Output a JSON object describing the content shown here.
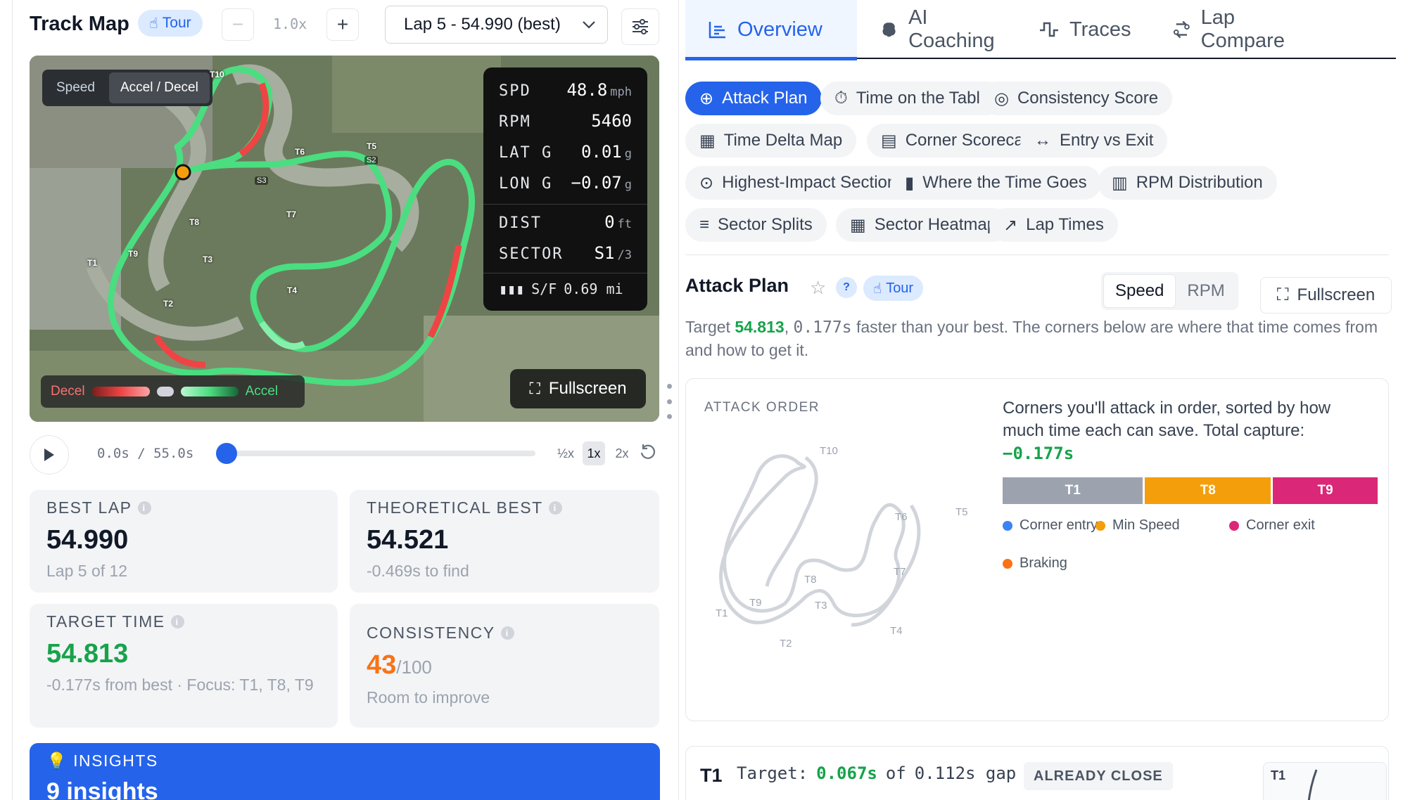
{
  "left": {
    "title": "Track Map",
    "tour_label": "Tour",
    "zoom_minus": "−",
    "zoom_level": "1.0x",
    "zoom_plus": "+",
    "lap_select": "Lap 5 - 54.990 (best)",
    "map": {
      "mode_speed": "Speed",
      "mode_accel": "Accel / Decel",
      "corners": [
        "T1",
        "T2",
        "T3",
        "T4",
        "T5",
        "T6",
        "T7",
        "T8",
        "T9",
        "T10"
      ],
      "sectors": [
        "S2",
        "S3"
      ],
      "telemetry": {
        "spd_label": "SPD",
        "spd_value": "48.8",
        "spd_unit": "mph",
        "rpm_label": "RPM",
        "rpm_value": "5460",
        "latg_label": "LAT G",
        "latg_value": "0.01",
        "latg_unit": "g",
        "long_label": "LON G",
        "long_value": "−0.07",
        "long_unit": "g",
        "dist_label": "DIST",
        "dist_value": "0",
        "dist_unit": "ft",
        "sector_label": "SECTOR",
        "sector_value": "S1",
        "sector_total": "/3",
        "sf_label": "S/F",
        "sf_value": "0.69 mi"
      },
      "legend_decel": "Decel",
      "legend_accel": "Accel",
      "fullscreen": "Fullscreen"
    },
    "playback": {
      "time": "0.0s / 55.0s",
      "progress": 0,
      "speeds": [
        "½x",
        "1x",
        "2x"
      ],
      "active_speed": "1x"
    },
    "cards": {
      "best_lap_label": "BEST LAP",
      "best_lap_value": "54.990",
      "best_lap_sub": "Lap 5 of 12",
      "theo_label": "THEORETICAL BEST",
      "theo_value": "54.521",
      "theo_sub": "-0.469s to find",
      "target_label": "TARGET TIME",
      "target_value": "54.813",
      "target_sub": "-0.177s from best · Focus: T1, T8, T9",
      "consistency_label": "CONSISTENCY",
      "consistency_value": "43",
      "consistency_max": "/100",
      "consistency_sub": "Room to improve"
    },
    "insights": {
      "label": "INSIGHTS",
      "count": "9 insights"
    }
  },
  "right": {
    "tabs": [
      {
        "label": "Overview",
        "icon": "bar-chart-icon"
      },
      {
        "label": "AI Coaching",
        "icon": "brain-icon"
      },
      {
        "label": "Traces",
        "icon": "trace-icon"
      },
      {
        "label": "Lap Compare",
        "icon": "compare-icon"
      }
    ],
    "chips": [
      "Attack Plan",
      "Time on the Table",
      "Consistency Score",
      "Time Delta Map",
      "Corner Scorecard",
      "Entry vs Exit",
      "Highest-Impact Sections",
      "Where the Time Goes",
      "RPM Distribution",
      "Sector Splits",
      "Sector Heatmap",
      "Lap Times"
    ],
    "attack": {
      "title": "Attack Plan",
      "help": "?",
      "tour": "Tour",
      "seg_speed": "Speed",
      "seg_rpm": "RPM",
      "fullscreen": "Fullscreen",
      "desc_pre": "Target ",
      "desc_target": "54.813",
      "desc_delta": "0.177s",
      "desc_post": " faster than your best. The corners below are where that time comes from and how to get it.",
      "order_label": "ATTACK ORDER",
      "order_desc": "Corners you'll attack in order, sorted by how much time each can save. Total capture:",
      "order_total": "−0.177s",
      "stack": [
        {
          "label": "T1",
          "share": 0.067,
          "color": "#9ca3af"
        },
        {
          "label": "T8",
          "share": 0.06,
          "color": "#f59e0b"
        },
        {
          "label": "T9",
          "share": 0.05,
          "color": "#db2777"
        }
      ],
      "legend": [
        {
          "label": "Corner entry",
          "color": "#3b82f6"
        },
        {
          "label": "Min Speed",
          "color": "#f59e0b"
        },
        {
          "label": "Corner exit",
          "color": "#db2777"
        },
        {
          "label": "Braking",
          "color": "#f97316"
        }
      ],
      "mini_corners": [
        "T10",
        "T6",
        "T5",
        "T7",
        "T8",
        "T1",
        "T9",
        "T3",
        "T2",
        "T4"
      ]
    },
    "t1": {
      "corner": "T1",
      "target_label": "Target:",
      "target_value": "0.067s",
      "of": "of",
      "gap": "0.112s gap",
      "badge": "ALREADY CLOSE",
      "mini_label": "T1"
    }
  }
}
